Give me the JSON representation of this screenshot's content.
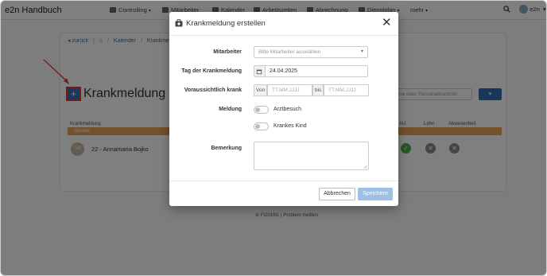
{
  "app": {
    "title": "e2n Handbuch"
  },
  "nav": {
    "items": [
      {
        "label": "Controlling",
        "icon": "chart-icon",
        "has_caret": true
      },
      {
        "label": "Mitarbeiter",
        "icon": "users-icon",
        "has_caret": false
      },
      {
        "label": "Kalender",
        "icon": "calendar-icon",
        "has_caret": false
      },
      {
        "label": "Arbeitszeiten",
        "icon": "clock-icon",
        "has_caret": false
      },
      {
        "label": "Abrechnung",
        "icon": "grid-icon",
        "has_caret": false
      },
      {
        "label": "Dienstplan",
        "icon": "calendar-icon",
        "has_caret": true
      },
      {
        "label": "mehr",
        "icon": "",
        "has_caret": true
      }
    ],
    "user_label": "e2n"
  },
  "breadcrumb": {
    "back": "zurück",
    "home_icon": "home-icon",
    "kalender": "Kalender",
    "current": "Krankmeldung"
  },
  "page": {
    "title": "Krankmeldung",
    "add_label": "+",
    "search_placeholder": "Name oder Personalnummer",
    "table_headers": {
      "krankmeldung": "Krankmeldung",
      "au": "AU",
      "lohn": "Lohn",
      "abwesenheit": "Abwesenheit"
    },
    "group_label": "Becker",
    "row": {
      "avatar_initials": "AB",
      "name": "22 - Annamaria Bojko"
    }
  },
  "footer": {
    "text": "FI201f61 | Problem melden"
  },
  "modal": {
    "title": "Krankmeldung erstellen",
    "close_label": "✕",
    "mitarbeiter_label": "Mitarbeiter",
    "mitarbeiter_placeholder": "Bitte Mitarbeiter auswählen",
    "tag_label": "Tag der Krankmeldung",
    "tag_value": "24.04.2025",
    "krank_label": "Voraussichtlich krank",
    "von_label": "Von",
    "von_placeholder": "TT.MM.JJJJ",
    "bis_label": "bis",
    "bis_placeholder": "TT.MM.JJJJ",
    "meldung_label": "Meldung",
    "toggle_arztbesuch": "Arztbesuch",
    "toggle_krankes_kind": "Krankes Kind",
    "bemerkung_label": "Bemerkung",
    "cancel_label": "Abbrechen",
    "save_label": "Speichern"
  },
  "colors": {
    "primary": "#2f6fb6",
    "accent_orange": "#e8a355",
    "highlight_red": "#e53935",
    "save_disabled": "#9cc0e6"
  }
}
